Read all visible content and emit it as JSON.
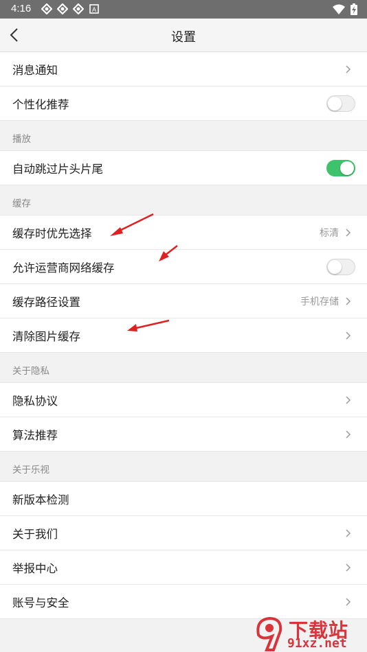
{
  "status_bar": {
    "time": "4:16"
  },
  "header": {
    "title": "设置"
  },
  "sections": [
    {
      "title": "",
      "rows": [
        {
          "label": "消息通知",
          "value": "",
          "control": "chevron"
        },
        {
          "label": "个性化推荐",
          "value": "",
          "control": "toggle",
          "on": false
        }
      ]
    },
    {
      "title": "播放",
      "rows": [
        {
          "label": "自动跳过片头片尾",
          "value": "",
          "control": "toggle",
          "on": true
        }
      ]
    },
    {
      "title": "缓存",
      "rows": [
        {
          "label": "缓存时优先选择",
          "value": "标清",
          "control": "chevron"
        },
        {
          "label": "允许运营商网络缓存",
          "value": "",
          "control": "toggle",
          "on": false
        },
        {
          "label": "缓存路径设置",
          "value": "手机存储",
          "control": "chevron"
        },
        {
          "label": "清除图片缓存",
          "value": "",
          "control": "chevron"
        }
      ]
    },
    {
      "title": "关于隐私",
      "rows": [
        {
          "label": "隐私协议",
          "value": "",
          "control": "chevron"
        },
        {
          "label": "算法推荐",
          "value": "",
          "control": "chevron"
        }
      ]
    },
    {
      "title": "关于乐视",
      "rows": [
        {
          "label": "新版本检测",
          "value": "",
          "control": "none"
        },
        {
          "label": "关于我们",
          "value": "",
          "control": "chevron"
        },
        {
          "label": "举报中心",
          "value": "",
          "control": "chevron"
        },
        {
          "label": "账号与安全",
          "value": "",
          "control": "chevron"
        }
      ]
    }
  ],
  "watermark": {
    "line1": "下载站",
    "line2": "91xz.net"
  },
  "colors": {
    "toggle_on": "#3cc36b",
    "annotation_arrow": "#e02020",
    "status_bar": "#6e6e6e"
  }
}
